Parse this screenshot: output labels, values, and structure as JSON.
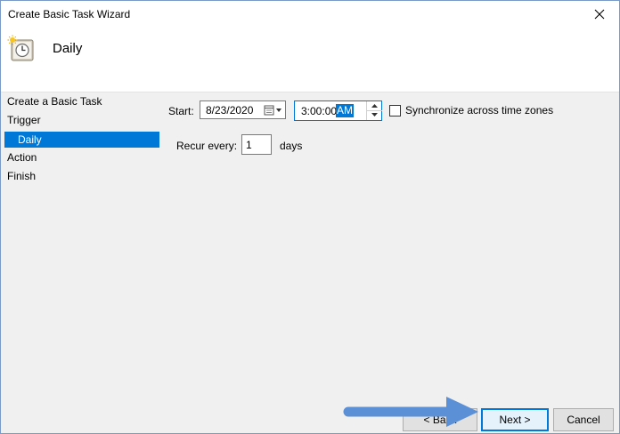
{
  "window": {
    "title": "Create Basic Task Wizard"
  },
  "header": {
    "title": "Daily",
    "icon": "task-scheduler-clock-icon"
  },
  "sidebar": {
    "items": [
      {
        "label": "Create a Basic Task"
      },
      {
        "label": "Trigger"
      },
      {
        "label": "Daily",
        "selected": true
      },
      {
        "label": "Action"
      },
      {
        "label": "Finish"
      }
    ]
  },
  "form": {
    "start_label": "Start:",
    "start_date": "8/23/2020",
    "start_time": "3:00:00",
    "start_ampm": "AM",
    "sync_label": "Synchronize across time zones",
    "sync_checked": false,
    "recur_label": "Recur every:",
    "recur_value": "1",
    "recur_unit": "days"
  },
  "buttons": {
    "back": "< Back",
    "next": "Next >",
    "cancel": "Cancel"
  },
  "colors": {
    "accent": "#0078d7",
    "arrow": "#5b8fd6"
  }
}
